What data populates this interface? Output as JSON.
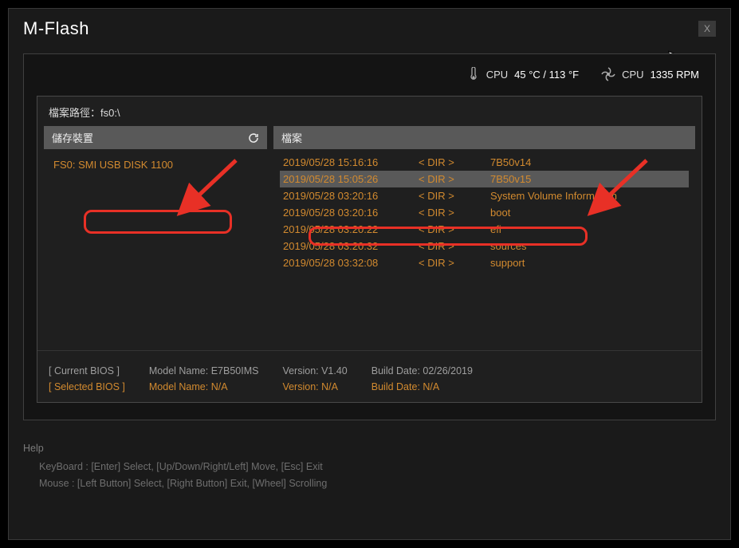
{
  "title": "M-Flash",
  "close_label": "X",
  "status": {
    "cpu_temp_label": "CPU",
    "cpu_temp_value": "45 °C / 113 °F",
    "cpu_fan_label": "CPU",
    "cpu_fan_value": "1335 RPM"
  },
  "path_label": "檔案路徑：",
  "path_value": "fs0:\\",
  "left": {
    "header": "儲存裝置",
    "device": "FS0: SMI USB DISK 1100"
  },
  "right": {
    "header": "檔案",
    "rows": [
      {
        "date": "2019/05/28 15:16:16",
        "type": "< DIR >",
        "name": "7B50v14",
        "selected": false
      },
      {
        "date": "2019/05/28 15:05:26",
        "type": "< DIR >",
        "name": "7B50v15",
        "selected": true
      },
      {
        "date": "2019/05/28 03:20:16",
        "type": "< DIR >",
        "name": "System Volume Information",
        "selected": false
      },
      {
        "date": "2019/05/28 03:20:16",
        "type": "< DIR >",
        "name": "boot",
        "selected": false
      },
      {
        "date": "2019/05/28 03:20:22",
        "type": "< DIR >",
        "name": "efi",
        "selected": false
      },
      {
        "date": "2019/05/28 03:20:32",
        "type": "< DIR >",
        "name": "sources",
        "selected": false
      },
      {
        "date": "2019/05/28 03:32:08",
        "type": "< DIR >",
        "name": "support",
        "selected": false
      }
    ]
  },
  "bios_footer": {
    "current_label": "[ Current BIOS   ]",
    "selected_label": "[ Selected BIOS ]",
    "model_current": "Model Name: E7B50IMS",
    "model_selected": "Model Name: N/A",
    "version_current": "Version: V1.40",
    "version_selected": "Version: N/A",
    "build_current": "Build Date: 02/26/2019",
    "build_selected": "Build Date: N/A"
  },
  "help": {
    "title": "Help",
    "keyboard": "KeyBoard :   [Enter]  Select,    [Up/Down/Right/Left]  Move,    [Esc]  Exit",
    "mouse": "Mouse     :   [Left Button]  Select,    [Right Button]  Exit,    [Wheel]  Scrolling"
  }
}
